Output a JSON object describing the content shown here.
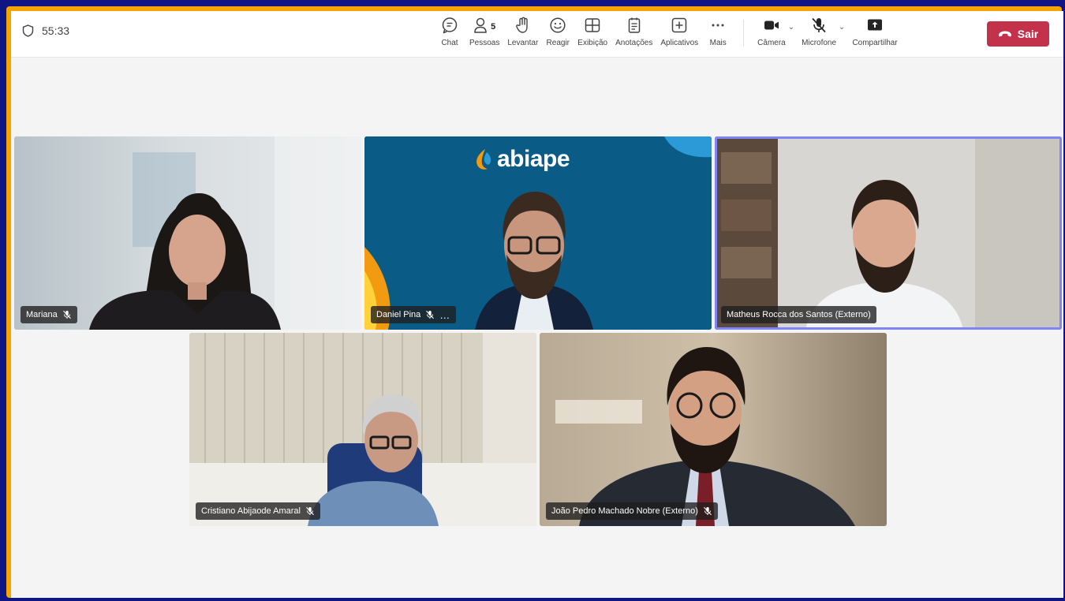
{
  "toolbar": {
    "timer": "55:33",
    "items": [
      {
        "label": "Chat"
      },
      {
        "label": "Pessoas",
        "count": "5"
      },
      {
        "label": "Levantar"
      },
      {
        "label": "Reagir"
      },
      {
        "label": "Exibição"
      },
      {
        "label": "Anotações"
      },
      {
        "label": "Aplicativos"
      },
      {
        "label": "Mais"
      }
    ],
    "devices": {
      "camera": "Câmera",
      "microphone": "Microfone",
      "share": "Compartilhar"
    },
    "leave_label": "Sair"
  },
  "participants": [
    {
      "name": "Mariana"
    },
    {
      "name": "Daniel Pina"
    },
    {
      "name": "Matheus Rocca dos Santos (Externo)"
    },
    {
      "name": "Cristiano Abijaode Amaral"
    },
    {
      "name": "João Pedro Machado Nobre (Externo)"
    }
  ],
  "background_logo": "abiape",
  "colors": {
    "frame_outer": "#0f1683",
    "frame_accent": "#f5a400",
    "leave": "#c4314b",
    "active_speaker": "#7f85f5",
    "brand_bg": "#0a5b86"
  }
}
